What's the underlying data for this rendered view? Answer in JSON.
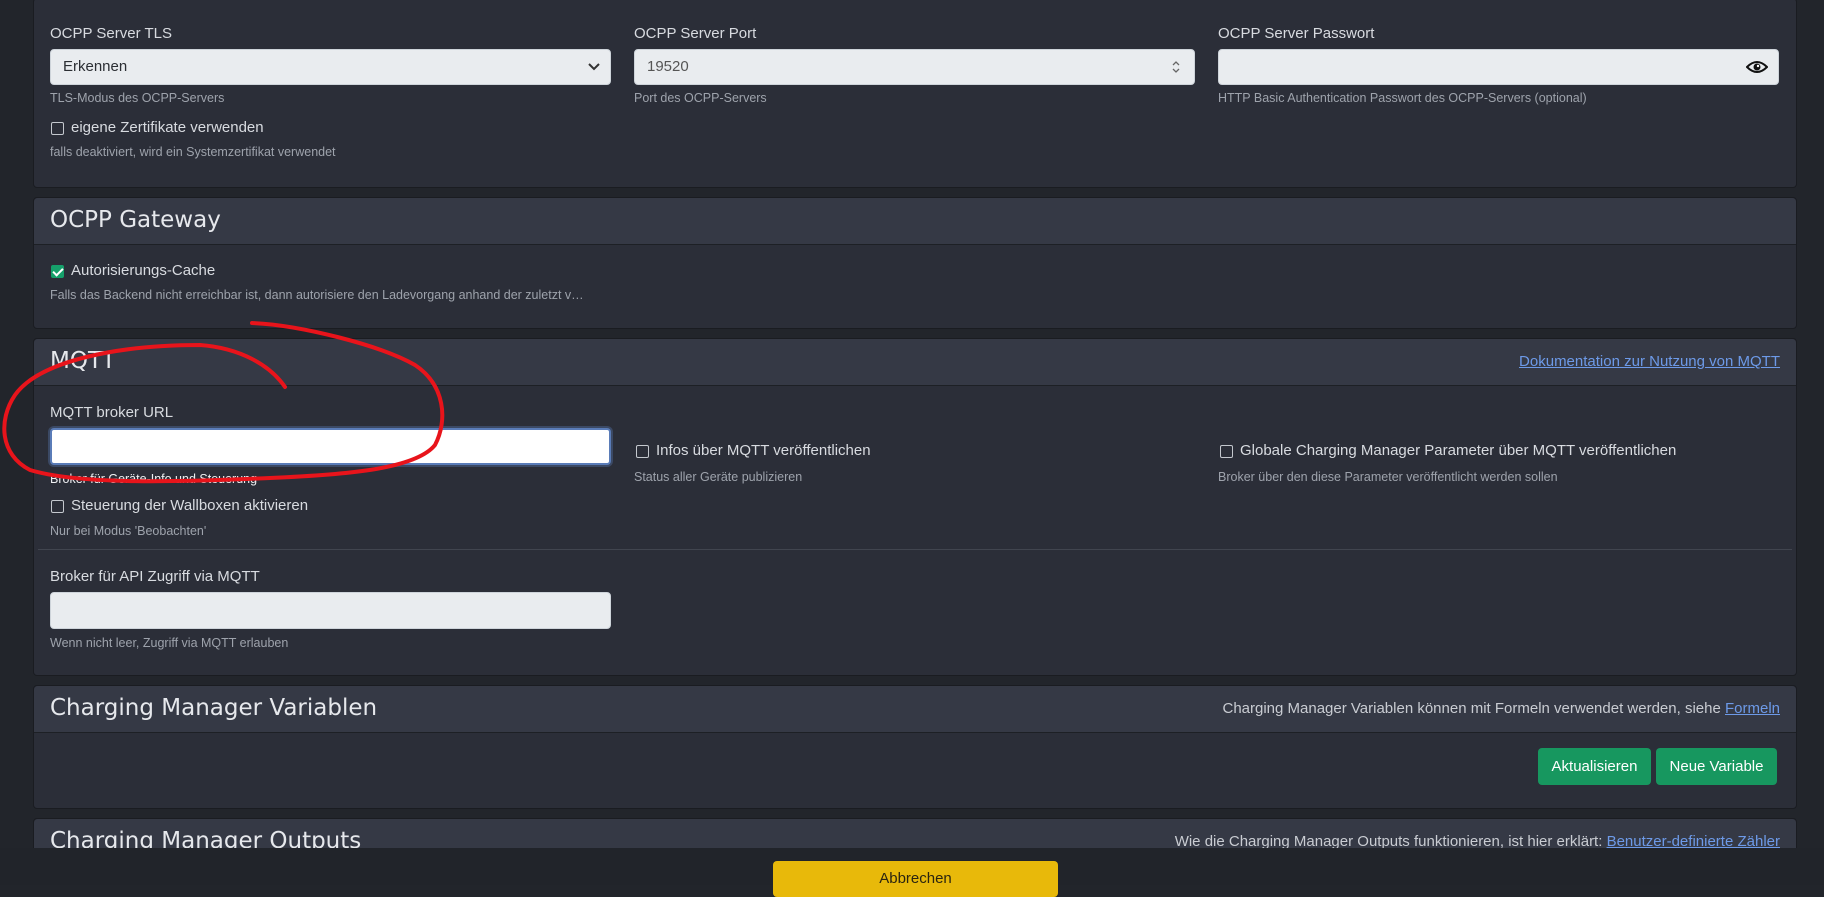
{
  "ocpp_server": {
    "tls_label": "OCPP Server TLS",
    "tls_value": "Erkennen",
    "tls_hint": "TLS-Modus des OCPP-Servers",
    "port_label": "OCPP Server Port",
    "port_value": "19520",
    "port_hint": "Port des OCPP-Servers",
    "password_label": "OCPP Server Passwort",
    "password_value": "",
    "password_hint": "HTTP Basic Authentication Passwort des OCPP-Servers (optional)",
    "own_certs_label": "eigene Zertifikate verwenden",
    "own_certs_checked": false,
    "own_certs_hint": "falls deaktiviert, wird ein Systemzertifikat verwendet"
  },
  "ocpp_gateway": {
    "title": "OCPP Gateway",
    "auth_cache_label": "Autorisierungs-Cache",
    "auth_cache_checked": true,
    "auth_cache_hint": "Falls das Backend nicht erreichbar ist, dann autorisiere den Ladevorgang anhand der zuletzt v…"
  },
  "mqtt": {
    "title": "MQTT",
    "doc_link": "Dokumentation zur Nutzung von MQTT",
    "broker_url_label": "MQTT broker URL",
    "broker_url_value": "",
    "broker_url_hint": "Broker für Geräte-Info und Steuerung",
    "publish_info_label": "Infos über MQTT veröffentlichen",
    "publish_info_hint": "Status aller Geräte publizieren",
    "publish_global_label": "Globale Charging Manager Parameter über MQTT veröffentlichen",
    "publish_global_hint": "Broker über den diese Parameter veröffentlicht werden sollen",
    "wallbox_control_label": "Steuerung der Wallboxen aktivieren",
    "wallbox_control_hint": "Nur bei Modus 'Beobachten'",
    "api_broker_label": "Broker für API Zugriff via MQTT",
    "api_broker_value": "",
    "api_broker_hint": "Wenn nicht leer, Zugriff via MQTT erlauben"
  },
  "variables": {
    "title": "Charging Manager Variablen",
    "header_text": "Charging Manager Variablen können mit Formeln verwendet werden, siehe ",
    "header_link": "Formeln",
    "refresh_button": "Aktualisieren",
    "new_button": "Neue Variable"
  },
  "outputs": {
    "title": "Charging Manager Outputs",
    "header_text": "Wie die Charging Manager Outputs funktionieren, ist hier erklärt: ",
    "header_link": "Benutzer-definierte Zähler"
  },
  "footer": {
    "cancel_button": "Abbrechen"
  },
  "colors": {
    "background": "#22252b",
    "card": "#2b2e38",
    "accent_green": "#17975f",
    "cancel_yellow": "#e8b90a",
    "link": "#6d9ae8",
    "annotation_red": "#e8141b"
  },
  "icons": {
    "select_chevron": "chevron-down-icon",
    "spinner": "spinner-arrows-icon",
    "password_toggle": "eye-icon"
  }
}
